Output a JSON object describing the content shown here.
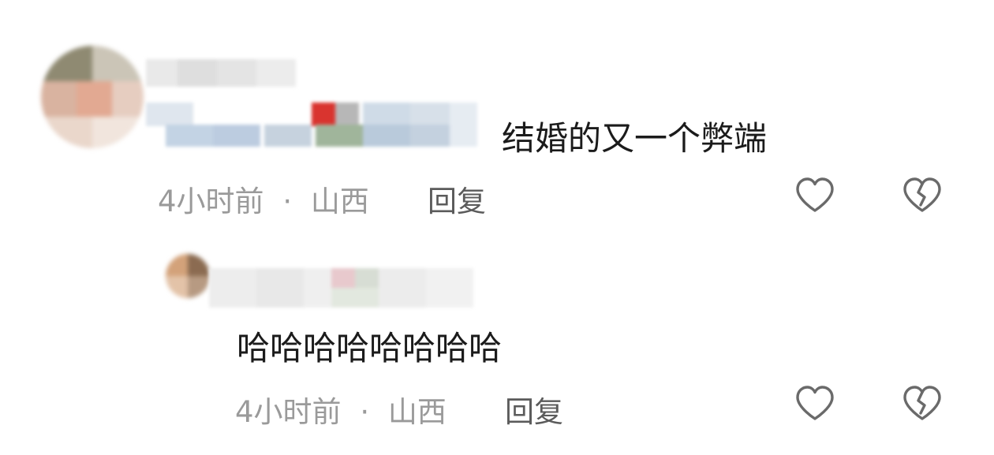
{
  "comments": [
    {
      "text": "结婚的又一个弊端",
      "time": "4小时前",
      "separator": "·",
      "location": "山西",
      "reply_label": "回复",
      "like_icon": "heart-outline-icon",
      "dislike_icon": "broken-heart-icon"
    },
    {
      "text": "哈哈哈哈哈哈哈哈",
      "time": "4小时前",
      "separator": "·",
      "location": "山西",
      "reply_label": "回复",
      "like_icon": "heart-outline-icon",
      "dislike_icon": "broken-heart-icon"
    }
  ],
  "colors": {
    "text": "#1b1b1b",
    "meta": "#9a9a9a",
    "reply": "#5b5b5b",
    "icon": "#6a6a6a"
  }
}
